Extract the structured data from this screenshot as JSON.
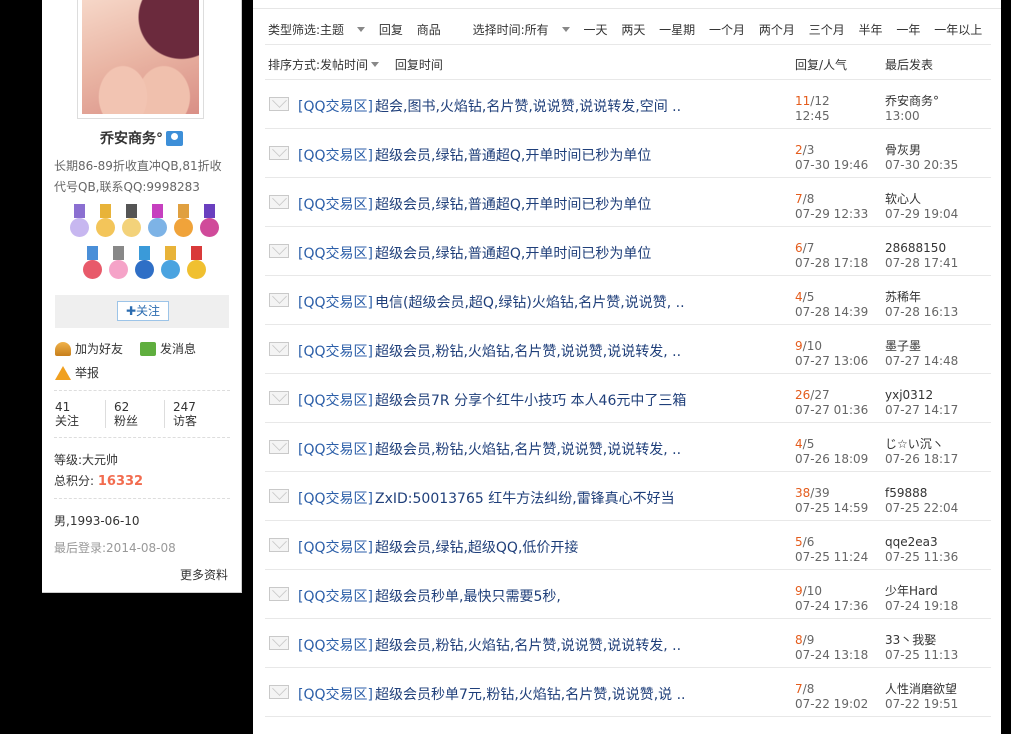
{
  "profile": {
    "username": "乔安商务°",
    "bio": "长期86-89折收直冲QB,81折收代号QB,联系QQ:9998283",
    "follow_label": "✚关注",
    "actions": {
      "add_friend": "加为好友",
      "message": "发消息",
      "report": "举报"
    },
    "stats": [
      {
        "value": "41",
        "label": "关注"
      },
      {
        "value": "62",
        "label": "粉丝"
      },
      {
        "value": "247",
        "label": "访客"
      }
    ],
    "level_label": "等级:",
    "level_value": "大元帅",
    "points_label": "总积分:",
    "points_value": "16332",
    "gender_birthday": "男,1993-06-10",
    "last_login": "最后登录:2014-08-08",
    "more": "更多资料"
  },
  "filters": {
    "type_label": "类型筛选:",
    "type_selected": "主题",
    "type_options": [
      "回复",
      "商品"
    ],
    "time_label": "选择时间:",
    "time_selected": "所有",
    "time_options": [
      "一天",
      "两天",
      "一星期",
      "一个月",
      "两个月",
      "三个月",
      "半年",
      "一年",
      "一年以上"
    ]
  },
  "sort": {
    "label": "排序方式:",
    "selected": "发帖时间",
    "other": "回复时间",
    "col_reply": "回复/人气",
    "col_last": "最后发表"
  },
  "threads": [
    {
      "cat": "[QQ交易区]",
      "title": "超会,图书,火焰钻,名片赞,说说赞,说说转发,空间 ..",
      "replies": "11",
      "views": "12",
      "time": "12:45",
      "last_user": "乔安商务°",
      "last_time": "13:00"
    },
    {
      "cat": "[QQ交易区]",
      "title": "超级会员,绿钻,普通超Q,开单时间已秒为单位",
      "replies": "2",
      "views": "3",
      "time": "07-30 19:46",
      "last_user": "骨灰男",
      "last_time": "07-30 20:35"
    },
    {
      "cat": "[QQ交易区]",
      "title": "超级会员,绿钻,普通超Q,开单时间已秒为单位",
      "replies": "7",
      "views": "8",
      "time": "07-29 12:33",
      "last_user": "软心人",
      "last_time": "07-29 19:04"
    },
    {
      "cat": "[QQ交易区]",
      "title": "超级会员,绿钻,普通超Q,开单时间已秒为单位",
      "replies": "6",
      "views": "7",
      "time": "07-28 17:18",
      "last_user": "28688150",
      "last_time": "07-28 17:41"
    },
    {
      "cat": "[QQ交易区]",
      "title": "电信(超级会员,超Q,绿钻)火焰钻,名片赞,说说赞, ..",
      "replies": "4",
      "views": "5",
      "time": "07-28 14:39",
      "last_user": "苏稀年",
      "last_time": "07-28 16:13"
    },
    {
      "cat": "[QQ交易区]",
      "title": "超级会员,粉钻,火焰钻,名片赞,说说赞,说说转发, ..",
      "replies": "9",
      "views": "10",
      "time": "07-27 13:06",
      "last_user": "墨子墨",
      "last_time": "07-27 14:48"
    },
    {
      "cat": "[QQ交易区]",
      "title": "超级会员7R 分享个红牛小技巧 本人46元中了三箱",
      "replies": "26",
      "views": "27",
      "time": "07-27 01:36",
      "last_user": "yxj0312",
      "last_time": "07-27 14:17"
    },
    {
      "cat": "[QQ交易区]",
      "title": "超级会员,粉钻,火焰钻,名片赞,说说赞,说说转发, ..",
      "replies": "4",
      "views": "5",
      "time": "07-26 18:09",
      "last_user": "じ☆い沉ヽ",
      "last_time": "07-26 18:17"
    },
    {
      "cat": "[QQ交易区]",
      "title": "ZxID:50013765 红牛方法纠纷,雷锋真心不好当",
      "replies": "38",
      "views": "39",
      "time": "07-25 14:59",
      "last_user": "f59888",
      "last_time": "07-25 22:04"
    },
    {
      "cat": "[QQ交易区]",
      "title": "超级会员,绿钻,超级QQ,低价开接",
      "replies": "5",
      "views": "6",
      "time": "07-25 11:24",
      "last_user": "qqe2ea3",
      "last_time": "07-25 11:36"
    },
    {
      "cat": "[QQ交易区]",
      "title": "超级会员秒单,最快只需要5秒,",
      "replies": "9",
      "views": "10",
      "time": "07-24 17:36",
      "last_user": "少年Hard",
      "last_time": "07-24 19:18"
    },
    {
      "cat": "[QQ交易区]",
      "title": "超级会员,粉钻,火焰钻,名片赞,说说赞,说说转发, ..",
      "replies": "8",
      "views": "9",
      "time": "07-24 13:18",
      "last_user": "33丶我娶",
      "last_time": "07-25 11:13"
    },
    {
      "cat": "[QQ交易区]",
      "title": "超级会员秒单7元,粉钻,火焰钻,名片赞,说说赞,说 ..",
      "replies": "7",
      "views": "8",
      "time": "07-22 19:02",
      "last_user": "人性消磨欲望",
      "last_time": "07-22 19:51"
    }
  ],
  "colors": {
    "accent": "#f26c4f",
    "link": "#2b5ea8",
    "reply": "#e45c1c"
  }
}
